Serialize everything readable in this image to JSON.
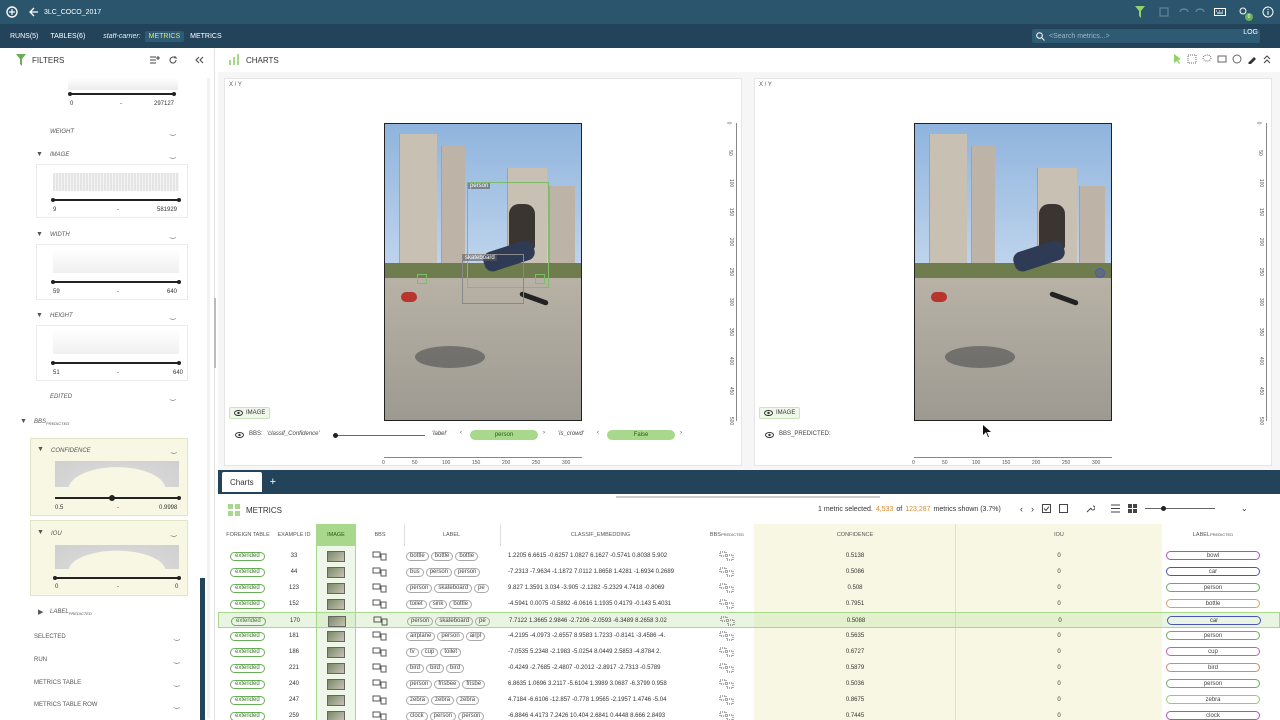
{
  "app": {
    "project": "3LC_COCO_2017",
    "notif_count": "0"
  },
  "nav": {
    "runs": "RUNS(5)",
    "tables": "TABLES(6)",
    "carrier_label": "staff-carrier:",
    "chip1": "METRICS",
    "chip2": "METRICS",
    "search_placeholder": "<Search metrics...>",
    "log": "LOG"
  },
  "filters": {
    "title": "FILTERS",
    "top_range": {
      "min": "0",
      "max": "297127"
    },
    "weight": "WEIGHT",
    "image": "IMAGE",
    "image_range": {
      "min": "9",
      "max": "581929"
    },
    "width": "WIDTH",
    "width_range": {
      "min": "59",
      "max": "640"
    },
    "height": "HEIGHT",
    "height_range": {
      "min": "51",
      "max": "640"
    },
    "edited": "EDITED",
    "bbs": "BBS",
    "bbs_sub": "PREDICTED",
    "confidence": "CONFIDENCE",
    "confidence_range": {
      "min": "0.5",
      "max": "0.9998"
    },
    "iou": "IOU",
    "iou_range": {
      "min": "0",
      "max": "0"
    },
    "label": "LABEL",
    "label_sub": "PREDICTED",
    "selected": "SELECTED",
    "run": "RUN",
    "metrics_table": "METRICS TABLE",
    "metrics_table_row": "METRICS TABLE ROW"
  },
  "charts": {
    "title": "CHARTS",
    "left": {
      "axis": "X / Y",
      "image_chip": "IMAGE",
      "bbs_label": "BBS:",
      "filter_key": "'classif_Confidence'",
      "label_key": "'label'",
      "label_value": "person",
      "crowd_key": "'is_crowd'",
      "crowd_value": "False",
      "bbox1": "person",
      "bbox2": "skateboard"
    },
    "right": {
      "axis": "X / Y",
      "image_chip": "IMAGE",
      "bbs_label": "BBS_PREDICTED:"
    },
    "y_ticks": [
      "0",
      "50",
      "100",
      "150",
      "200",
      "250",
      "300",
      "350",
      "400",
      "450",
      "500"
    ],
    "x_ticks": [
      "0",
      "50",
      "100",
      "150",
      "200",
      "250",
      "300"
    ]
  },
  "tabs": {
    "charts": "Charts",
    "add": "+"
  },
  "metrics": {
    "title": "METRICS",
    "selected_text": "1 metric selected.",
    "shown_count": "4,533",
    "of": "of",
    "total": "123,287",
    "shown_suffix": "metrics shown (3.7%)",
    "headers": {
      "foreign": "FOREIGN TABLE",
      "example_id": "EXAMPLE ID",
      "image": "IMAGE",
      "bbs": "BBS",
      "label": "LABEL",
      "embedding": "CLASSIF_EMBEDDING",
      "bbs_pred": "BBS",
      "bbs_pred_sub": "PREDICTED",
      "confidence": "CONFIDENCE",
      "iou": "IOU",
      "label_pred": "LABEL",
      "label_pred_sub": "PREDICTED"
    },
    "rows": [
      {
        "ft": "extended",
        "id": "33",
        "labels": [
          "bottle",
          "bottle",
          "bottle"
        ],
        "emb": "1.2205  6.6615  -0.6257  1.0827  6.1627  -0.5741  0.8038  5.902",
        "conf": "0.5138",
        "iou": "0",
        "pred": "bowl",
        "pcolor": "#b14fc0"
      },
      {
        "ft": "extended",
        "id": "44",
        "labels": [
          "bus",
          "person",
          "person"
        ],
        "emb": "-7.2313  -7.9634  -1.1872  7.0112  1.8658  1.4281  -1.6934  0.2689",
        "conf": "0.5086",
        "iou": "0",
        "pred": "car",
        "pcolor": "#4a55b8"
      },
      {
        "ft": "extended",
        "id": "123",
        "labels": [
          "person",
          "skateboard",
          "pe"
        ],
        "emb": "9.827  1.3591  3.034  -3.905  -2.1282  -5.2329  4.7418  -0.8069",
        "conf": "0.508",
        "iou": "0",
        "pred": "person",
        "pcolor": "#6aaf58"
      },
      {
        "ft": "extended",
        "id": "152",
        "labels": [
          "toilet",
          "sink",
          "bottle"
        ],
        "emb": "-4.5941  0.0075  -0.5892  -6.0616  1.1935  0.4179  -0.143  5.4031",
        "conf": "0.7951",
        "iou": "0",
        "pred": "bottle",
        "pcolor": "#d9a066"
      },
      {
        "ft": "extended",
        "id": "170",
        "labels": [
          "person",
          "skateboard",
          "pe"
        ],
        "emb": "7.7122  1.3665  2.9846  -2.7206  -2.0593  -6.3489  8.2658  3.02",
        "conf": "0.5088",
        "iou": "0",
        "pred": "car",
        "pcolor": "#4a55b8"
      },
      {
        "ft": "extended",
        "id": "181",
        "labels": [
          "airplane",
          "person",
          "airpl"
        ],
        "emb": "-4.2195  -4.0973  -2.6557  8.9583  1.7233  -0.8141  -3.4586  -4.",
        "conf": "0.5635",
        "iou": "0",
        "pred": "person",
        "pcolor": "#6aaf58"
      },
      {
        "ft": "extended",
        "id": "186",
        "labels": [
          "tv",
          "cup",
          "toilet"
        ],
        "emb": "-7.0535  5.2348  -2.1983  -5.0254  8.0449  2.5853  -4.8784  2.",
        "conf": "0.6727",
        "iou": "0",
        "pred": "cup",
        "pcolor": "#c85fb0"
      },
      {
        "ft": "extended",
        "id": "221",
        "labels": [
          "bird",
          "bird",
          "bird"
        ],
        "emb": "-0.4249  -2.7685  -2.4807  -0.2012  -2.8917  -2.7313  -0.5789",
        "conf": "0.5879",
        "iou": "0",
        "pred": "bird",
        "pcolor": "#d98a6a"
      },
      {
        "ft": "extended",
        "id": "240",
        "labels": [
          "person",
          "frisbee",
          "frisbe"
        ],
        "emb": "6.8635  1.0696  3.2117  -5.6104  1.3989  3.0687  -6.3799  0.958",
        "conf": "0.5036",
        "iou": "0",
        "pred": "person",
        "pcolor": "#6aaf58"
      },
      {
        "ft": "extended",
        "id": "247",
        "labels": [
          "zebra",
          "zebra",
          "zebra"
        ],
        "emb": "4.7184  -6.6106  -12.857  -0.778  1.9565  -2.1957  1.4746  -5.04",
        "conf": "0.8675",
        "iou": "0",
        "pred": "zebra",
        "pcolor": "#9ac86a"
      },
      {
        "ft": "extended",
        "id": "259",
        "labels": [
          "clock",
          "person",
          "person"
        ],
        "emb": "-6.8846  4.4173  7.2426  10.404  2.6841  0.4448  8.666  2.8493",
        "conf": "0.7445",
        "iou": "0",
        "pred": "clock",
        "pcolor": "#b14fc0"
      }
    ]
  }
}
